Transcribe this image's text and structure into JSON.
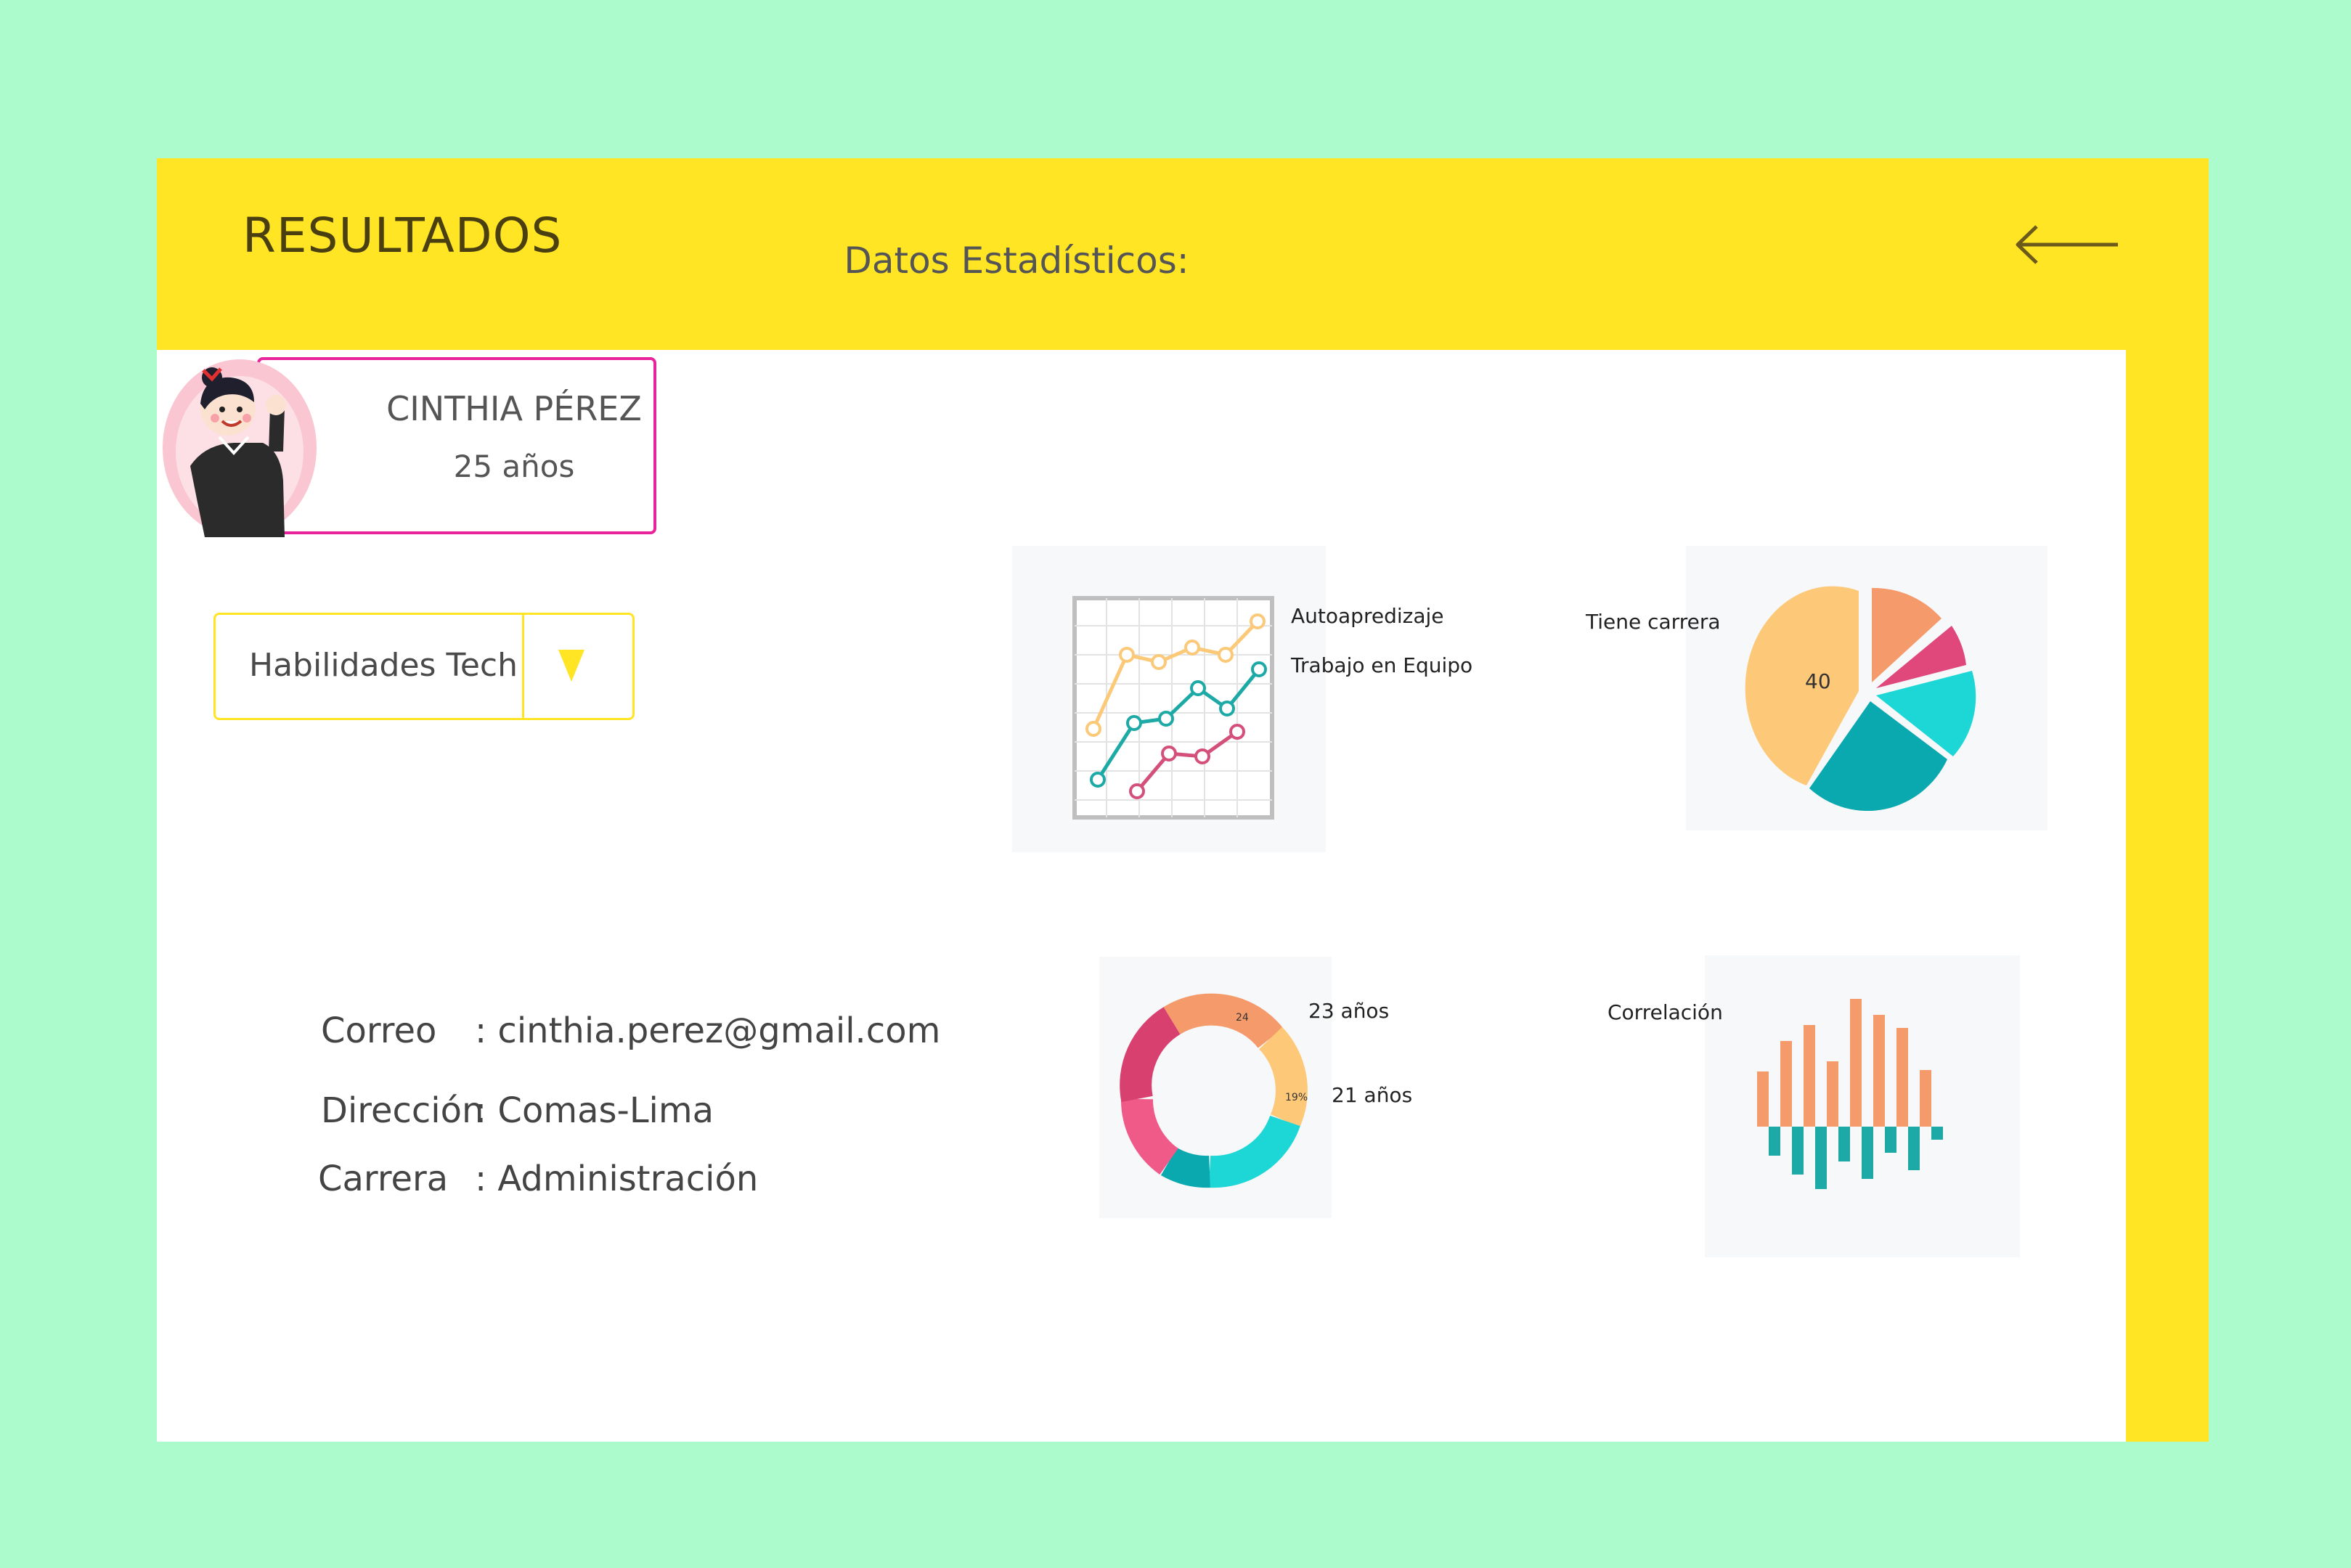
{
  "header": {
    "title": "RESULTADOS",
    "back_icon": "arrow-left-icon"
  },
  "section_title": "Datos Estadísticos:",
  "profile": {
    "name": "CINTHIA PÉREZ",
    "age": "25 años",
    "avatar_icon": "woman-avatar-icon"
  },
  "skills_dropdown": {
    "selected": "Habilidades Tech",
    "icon": "triangle-down-icon"
  },
  "info": {
    "email": {
      "label": "Correo",
      "value": ": cinthia.perez@gmail.com"
    },
    "address": {
      "label": "Dirección",
      "value": ": Comas-Lima"
    },
    "career": {
      "label": "Carrera",
      "value": ": Administración"
    }
  },
  "charts": {
    "line": {
      "captions": [
        "Autoapredizaje",
        "Trabajo en Equipo"
      ]
    },
    "pie": {
      "caption": "Tiene carrera",
      "slice_label": "40"
    },
    "donut": {
      "captions": [
        "23 años",
        "21 años"
      ],
      "slice_labels": [
        "24",
        "19%"
      ]
    },
    "bars": {
      "caption": "Correlación"
    }
  },
  "colors": {
    "background": "#acfbcc",
    "header": "#ffe524",
    "card_border": "#e8239c",
    "orange": "#f59a6a",
    "pink": "#e0477a",
    "teal": "#1ec9c9",
    "dark_teal": "#0aa9b0",
    "yellow_light": "#fdc878"
  }
}
